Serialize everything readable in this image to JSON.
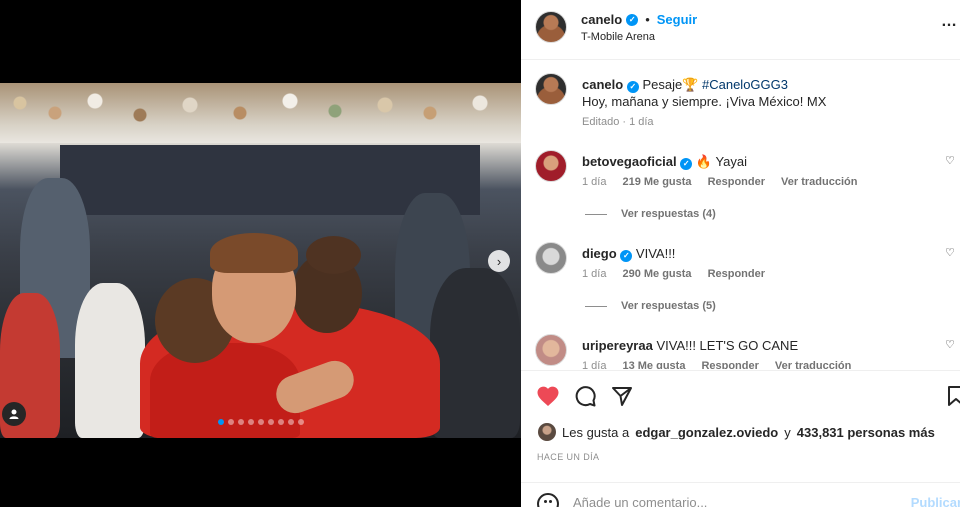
{
  "post": {
    "username": "canelo",
    "separator": "•",
    "follow_label": "Seguir",
    "location": "T-Mobile Arena",
    "more_label": "…"
  },
  "caption": {
    "username": "canelo",
    "text_before": "Pesaje",
    "emoji": "🏆",
    "hashtag": "#CaneloGGG3",
    "line2": "Hoy, mañana y siempre. ¡Viva México! MX",
    "meta": "Editado · 1 día"
  },
  "comments": [
    {
      "username": "betovegaoficial",
      "text": "🔥 Yayai",
      "time": "1 día",
      "likes": "219 Me gusta",
      "reply_label": "Responder",
      "translate_label": "Ver traducción",
      "view_replies": "Ver respuestas (4)"
    },
    {
      "username": "diego",
      "text": "VIVA!!!",
      "time": "1 día",
      "likes": "290 Me gusta",
      "reply_label": "Responder",
      "view_replies": "Ver respuestas (5)"
    },
    {
      "username": "uripereyraa",
      "text": "VIVA!!! LET'S GO CANE",
      "time": "1 día",
      "likes": "13 Me gusta",
      "reply_label": "Responder",
      "translate_label": "Ver traducción"
    }
  ],
  "likes": {
    "prefix": "Les gusta a",
    "user": "edgar_gonzalez.oviedo",
    "connector": "y",
    "count": "433,831 personas más"
  },
  "time_ago": "HACE UN DÍA",
  "comment_box": {
    "placeholder": "Añade un comentario...",
    "publish_label": "Publicar"
  },
  "carousel": {
    "total": 9,
    "active": 0
  },
  "colors": {
    "accent": "#0095f6",
    "like": "#ed4956"
  }
}
